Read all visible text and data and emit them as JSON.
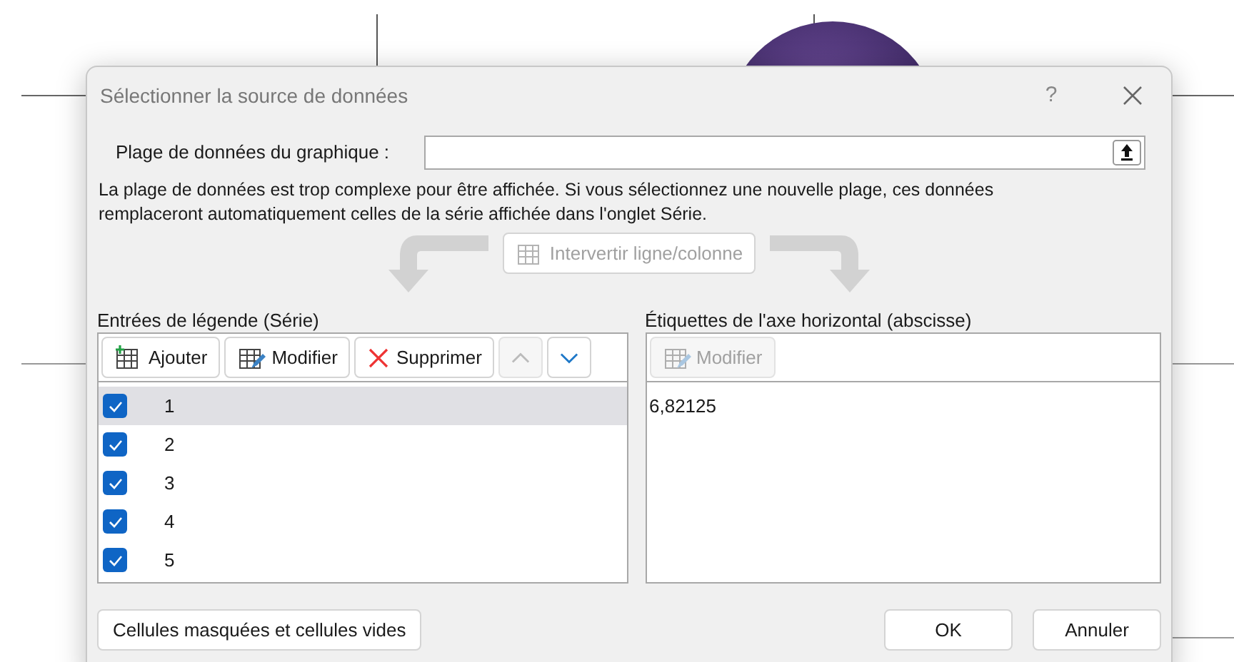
{
  "dialog": {
    "title": "Sélectionner la source de données",
    "help": "?",
    "range_label": "Plage de données du graphique :",
    "message": "La plage de données est trop complexe pour être affichée. Si vous sélectionnez une nouvelle plage, ces données remplaceront automatiquement celles de la série affichée dans l'onglet Série.",
    "switch_button": {
      "label": "Intervertir ligne/colonne",
      "disabled": true
    },
    "series_panel": {
      "title": "Entrées de légende (Série)",
      "toolbar": [
        {
          "kind": "add",
          "label": "Ajouter",
          "disabled": false
        },
        {
          "kind": "edit",
          "label": "Modifier",
          "disabled": false
        },
        {
          "kind": "delete",
          "label": "Supprimer",
          "disabled": false
        },
        {
          "kind": "up",
          "disabled": true
        },
        {
          "kind": "down",
          "disabled": false
        }
      ],
      "items": [
        {
          "label": "1",
          "checked": true,
          "selected": true
        },
        {
          "label": "2",
          "checked": true,
          "selected": false
        },
        {
          "label": "3",
          "checked": true,
          "selected": false
        },
        {
          "label": "4",
          "checked": true,
          "selected": false
        },
        {
          "label": "5",
          "checked": true,
          "selected": false
        }
      ]
    },
    "axis_panel": {
      "title": "Étiquettes de l'axe horizontal (abscisse)",
      "edit_button": {
        "label": "Modifier",
        "disabled": true
      },
      "items": [
        "6,82125"
      ]
    },
    "hidden_cells_button": "Cellules masquées et cellules vides",
    "buttons": [
      "OK",
      "Annuler"
    ]
  }
}
